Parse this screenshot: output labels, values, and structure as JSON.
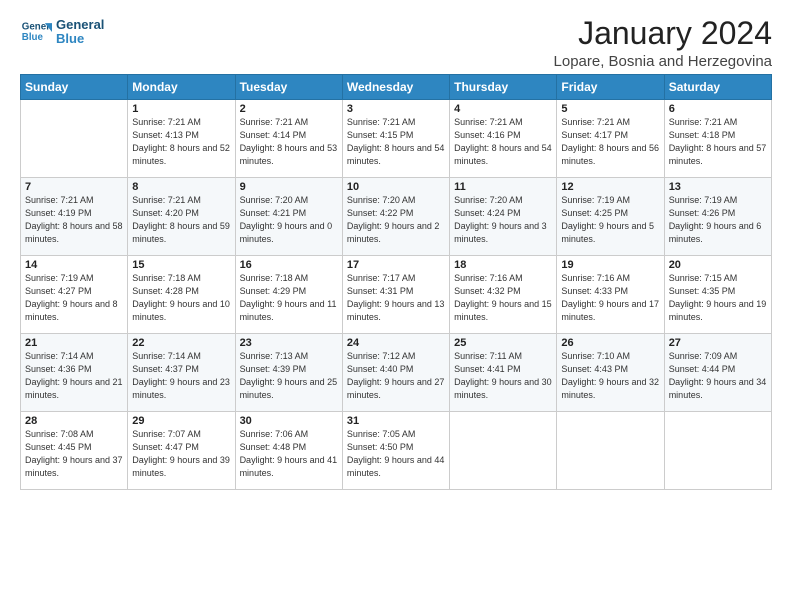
{
  "header": {
    "logo_line1": "General",
    "logo_line2": "Blue",
    "month": "January 2024",
    "location": "Lopare, Bosnia and Herzegovina"
  },
  "weekdays": [
    "Sunday",
    "Monday",
    "Tuesday",
    "Wednesday",
    "Thursday",
    "Friday",
    "Saturday"
  ],
  "weeks": [
    [
      {
        "day": "",
        "sunrise": "",
        "sunset": "",
        "daylight": ""
      },
      {
        "day": "1",
        "sunrise": "Sunrise: 7:21 AM",
        "sunset": "Sunset: 4:13 PM",
        "daylight": "Daylight: 8 hours and 52 minutes."
      },
      {
        "day": "2",
        "sunrise": "Sunrise: 7:21 AM",
        "sunset": "Sunset: 4:14 PM",
        "daylight": "Daylight: 8 hours and 53 minutes."
      },
      {
        "day": "3",
        "sunrise": "Sunrise: 7:21 AM",
        "sunset": "Sunset: 4:15 PM",
        "daylight": "Daylight: 8 hours and 54 minutes."
      },
      {
        "day": "4",
        "sunrise": "Sunrise: 7:21 AM",
        "sunset": "Sunset: 4:16 PM",
        "daylight": "Daylight: 8 hours and 54 minutes."
      },
      {
        "day": "5",
        "sunrise": "Sunrise: 7:21 AM",
        "sunset": "Sunset: 4:17 PM",
        "daylight": "Daylight: 8 hours and 56 minutes."
      },
      {
        "day": "6",
        "sunrise": "Sunrise: 7:21 AM",
        "sunset": "Sunset: 4:18 PM",
        "daylight": "Daylight: 8 hours and 57 minutes."
      }
    ],
    [
      {
        "day": "7",
        "sunrise": "Sunrise: 7:21 AM",
        "sunset": "Sunset: 4:19 PM",
        "daylight": "Daylight: 8 hours and 58 minutes."
      },
      {
        "day": "8",
        "sunrise": "Sunrise: 7:21 AM",
        "sunset": "Sunset: 4:20 PM",
        "daylight": "Daylight: 8 hours and 59 minutes."
      },
      {
        "day": "9",
        "sunrise": "Sunrise: 7:20 AM",
        "sunset": "Sunset: 4:21 PM",
        "daylight": "Daylight: 9 hours and 0 minutes."
      },
      {
        "day": "10",
        "sunrise": "Sunrise: 7:20 AM",
        "sunset": "Sunset: 4:22 PM",
        "daylight": "Daylight: 9 hours and 2 minutes."
      },
      {
        "day": "11",
        "sunrise": "Sunrise: 7:20 AM",
        "sunset": "Sunset: 4:24 PM",
        "daylight": "Daylight: 9 hours and 3 minutes."
      },
      {
        "day": "12",
        "sunrise": "Sunrise: 7:19 AM",
        "sunset": "Sunset: 4:25 PM",
        "daylight": "Daylight: 9 hours and 5 minutes."
      },
      {
        "day": "13",
        "sunrise": "Sunrise: 7:19 AM",
        "sunset": "Sunset: 4:26 PM",
        "daylight": "Daylight: 9 hours and 6 minutes."
      }
    ],
    [
      {
        "day": "14",
        "sunrise": "Sunrise: 7:19 AM",
        "sunset": "Sunset: 4:27 PM",
        "daylight": "Daylight: 9 hours and 8 minutes."
      },
      {
        "day": "15",
        "sunrise": "Sunrise: 7:18 AM",
        "sunset": "Sunset: 4:28 PM",
        "daylight": "Daylight: 9 hours and 10 minutes."
      },
      {
        "day": "16",
        "sunrise": "Sunrise: 7:18 AM",
        "sunset": "Sunset: 4:29 PM",
        "daylight": "Daylight: 9 hours and 11 minutes."
      },
      {
        "day": "17",
        "sunrise": "Sunrise: 7:17 AM",
        "sunset": "Sunset: 4:31 PM",
        "daylight": "Daylight: 9 hours and 13 minutes."
      },
      {
        "day": "18",
        "sunrise": "Sunrise: 7:16 AM",
        "sunset": "Sunset: 4:32 PM",
        "daylight": "Daylight: 9 hours and 15 minutes."
      },
      {
        "day": "19",
        "sunrise": "Sunrise: 7:16 AM",
        "sunset": "Sunset: 4:33 PM",
        "daylight": "Daylight: 9 hours and 17 minutes."
      },
      {
        "day": "20",
        "sunrise": "Sunrise: 7:15 AM",
        "sunset": "Sunset: 4:35 PM",
        "daylight": "Daylight: 9 hours and 19 minutes."
      }
    ],
    [
      {
        "day": "21",
        "sunrise": "Sunrise: 7:14 AM",
        "sunset": "Sunset: 4:36 PM",
        "daylight": "Daylight: 9 hours and 21 minutes."
      },
      {
        "day": "22",
        "sunrise": "Sunrise: 7:14 AM",
        "sunset": "Sunset: 4:37 PM",
        "daylight": "Daylight: 9 hours and 23 minutes."
      },
      {
        "day": "23",
        "sunrise": "Sunrise: 7:13 AM",
        "sunset": "Sunset: 4:39 PM",
        "daylight": "Daylight: 9 hours and 25 minutes."
      },
      {
        "day": "24",
        "sunrise": "Sunrise: 7:12 AM",
        "sunset": "Sunset: 4:40 PM",
        "daylight": "Daylight: 9 hours and 27 minutes."
      },
      {
        "day": "25",
        "sunrise": "Sunrise: 7:11 AM",
        "sunset": "Sunset: 4:41 PM",
        "daylight": "Daylight: 9 hours and 30 minutes."
      },
      {
        "day": "26",
        "sunrise": "Sunrise: 7:10 AM",
        "sunset": "Sunset: 4:43 PM",
        "daylight": "Daylight: 9 hours and 32 minutes."
      },
      {
        "day": "27",
        "sunrise": "Sunrise: 7:09 AM",
        "sunset": "Sunset: 4:44 PM",
        "daylight": "Daylight: 9 hours and 34 minutes."
      }
    ],
    [
      {
        "day": "28",
        "sunrise": "Sunrise: 7:08 AM",
        "sunset": "Sunset: 4:45 PM",
        "daylight": "Daylight: 9 hours and 37 minutes."
      },
      {
        "day": "29",
        "sunrise": "Sunrise: 7:07 AM",
        "sunset": "Sunset: 4:47 PM",
        "daylight": "Daylight: 9 hours and 39 minutes."
      },
      {
        "day": "30",
        "sunrise": "Sunrise: 7:06 AM",
        "sunset": "Sunset: 4:48 PM",
        "daylight": "Daylight: 9 hours and 41 minutes."
      },
      {
        "day": "31",
        "sunrise": "Sunrise: 7:05 AM",
        "sunset": "Sunset: 4:50 PM",
        "daylight": "Daylight: 9 hours and 44 minutes."
      },
      {
        "day": "",
        "sunrise": "",
        "sunset": "",
        "daylight": ""
      },
      {
        "day": "",
        "sunrise": "",
        "sunset": "",
        "daylight": ""
      },
      {
        "day": "",
        "sunrise": "",
        "sunset": "",
        "daylight": ""
      }
    ]
  ]
}
